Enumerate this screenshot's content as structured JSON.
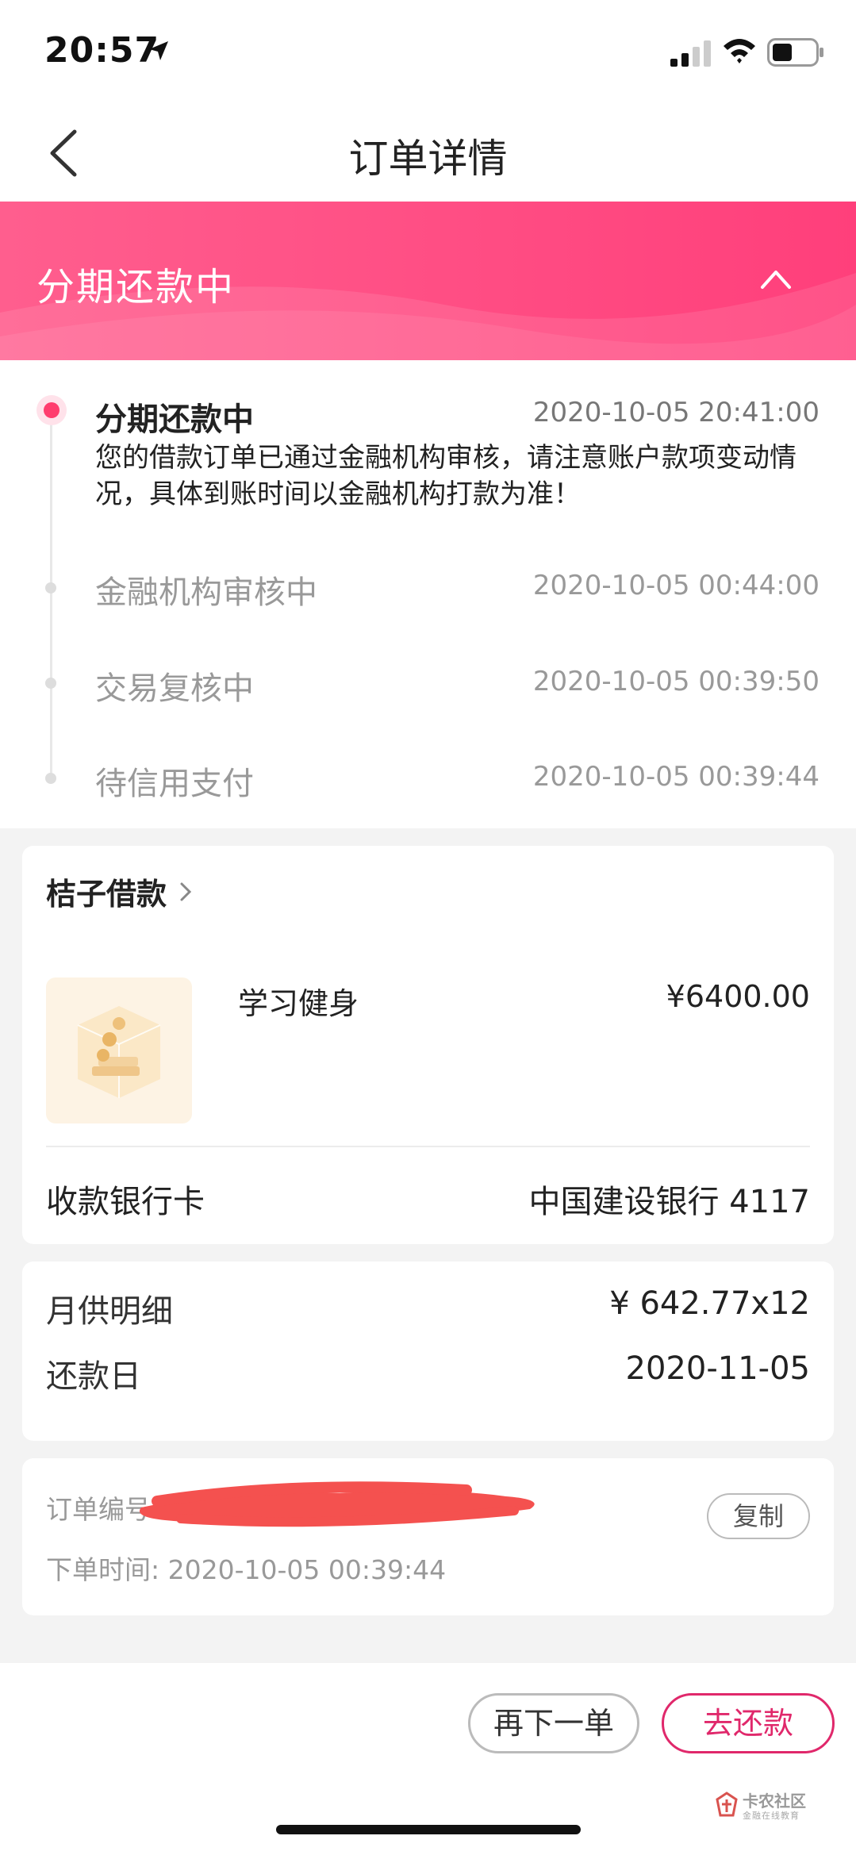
{
  "status_bar": {
    "time": "20:57"
  },
  "nav": {
    "title": "订单详情"
  },
  "banner": {
    "title": "分期还款中"
  },
  "timeline": {
    "items": [
      {
        "status": "分期还款中",
        "time": "2020-10-05 20:41:00",
        "description": "您的借款订单已通过金融机构审核，请注意账户款项变动情况，具体到账时间以金融机构打款为准！"
      },
      {
        "status": "金融机构审核中",
        "time": "2020-10-05 00:44:00"
      },
      {
        "status": "交易复核中",
        "time": "2020-10-05 00:39:50"
      },
      {
        "status": "待信用支付",
        "time": "2020-10-05 00:39:44"
      }
    ]
  },
  "lender": {
    "name": "桔子借款",
    "product_name": "学习健身",
    "amount": "¥6400.00",
    "bank_label": "收款银行卡",
    "bank_value": "中国建设银行 4117"
  },
  "repayment": {
    "monthly_label": "月供明细",
    "monthly_value": "¥ 642.77x12",
    "due_label": "还款日",
    "due_value": "2020-11-05"
  },
  "order": {
    "number_label": "订单编号:",
    "time_text": "下单时间: 2020-10-05 00:39:44",
    "copy_label": "复制"
  },
  "actions": {
    "reorder_label": "再下一单",
    "repay_label": "去还款"
  },
  "watermark": {
    "text": "卡农社区",
    "subtext": "金融在线教育"
  },
  "colors": {
    "accent": "#ff3d6e",
    "banner": "#ff4f85",
    "repay_button": "#e0286b"
  }
}
